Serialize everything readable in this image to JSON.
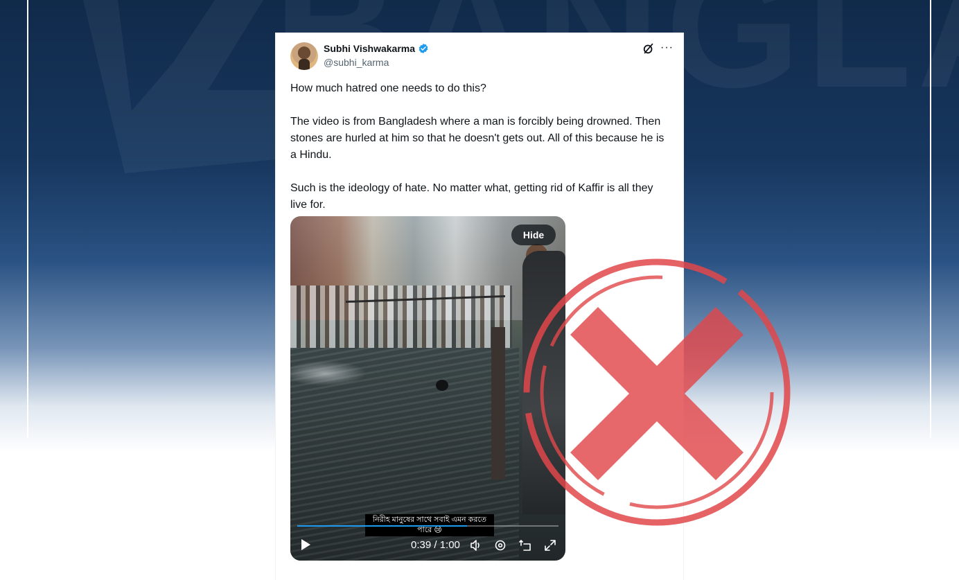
{
  "background": {
    "watermark_text": "BANGLA",
    "colors": {
      "navy_top": "#102a4a",
      "navy_mid": "#2a5283",
      "white": "#ffffff"
    }
  },
  "tweet": {
    "author": {
      "display_name": "Subhi Vishwakarma",
      "handle": "@subhi_karma",
      "verified": true
    },
    "icons": {
      "grok": "grok-icon",
      "more": "more-icon"
    },
    "text": {
      "line1": "How much hatred one needs to do this?",
      "line2": "The video is from Bangladesh where a man is forcibly being drowned. Then stones are hurled at him so that he doesn't gets out. All of this because he is a Hindu.",
      "line3": "Such is the ideology of hate. No matter what, getting rid of Kaffir is all they live for."
    },
    "video": {
      "hide_label": "Hide",
      "caption": "নিরীহ মানুষের সাথে সবাই এমন করতে পারে 😢",
      "time": "0:39 / 1:00",
      "progress": 0.65,
      "controls": [
        "play-icon",
        "volume-icon",
        "settings-icon",
        "dock-icon",
        "fullscreen-icon"
      ]
    }
  },
  "overlay": {
    "stamp": "fact-check-false-x",
    "color": "#e0474a"
  }
}
